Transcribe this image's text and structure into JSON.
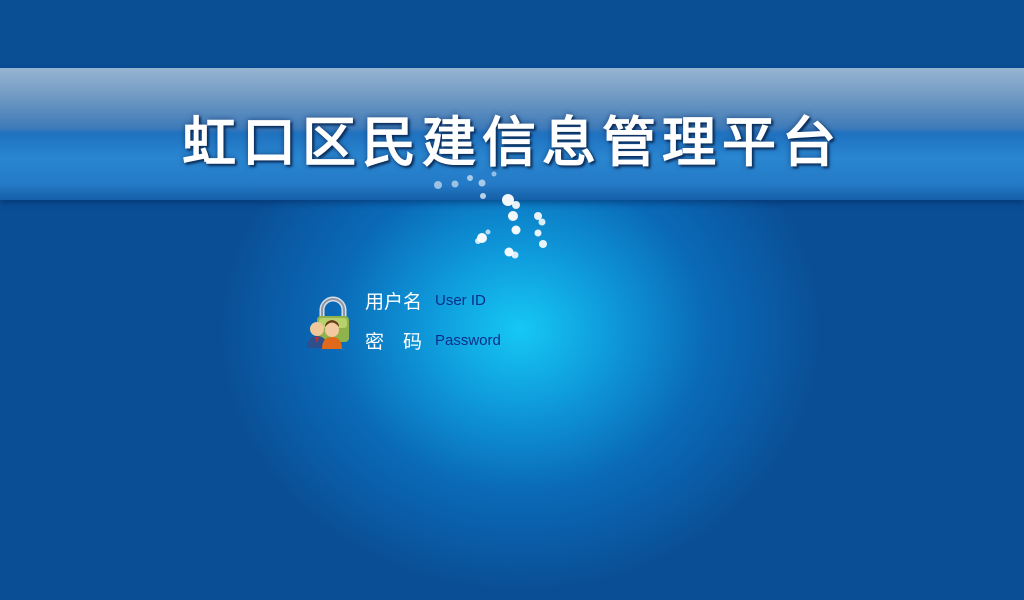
{
  "header": {
    "title": "虹口区民建信息管理平台"
  },
  "login": {
    "icon": "lock-users-icon",
    "user": {
      "label": "用户名",
      "placeholder": "User ID",
      "value": ""
    },
    "password": {
      "label": "密　码",
      "placeholder": "Password",
      "value": ""
    }
  },
  "colors": {
    "background": "#0a4f96",
    "glow": "#16c8f4",
    "title_text": "#ffffff",
    "input_text": "#0a2f8a"
  }
}
